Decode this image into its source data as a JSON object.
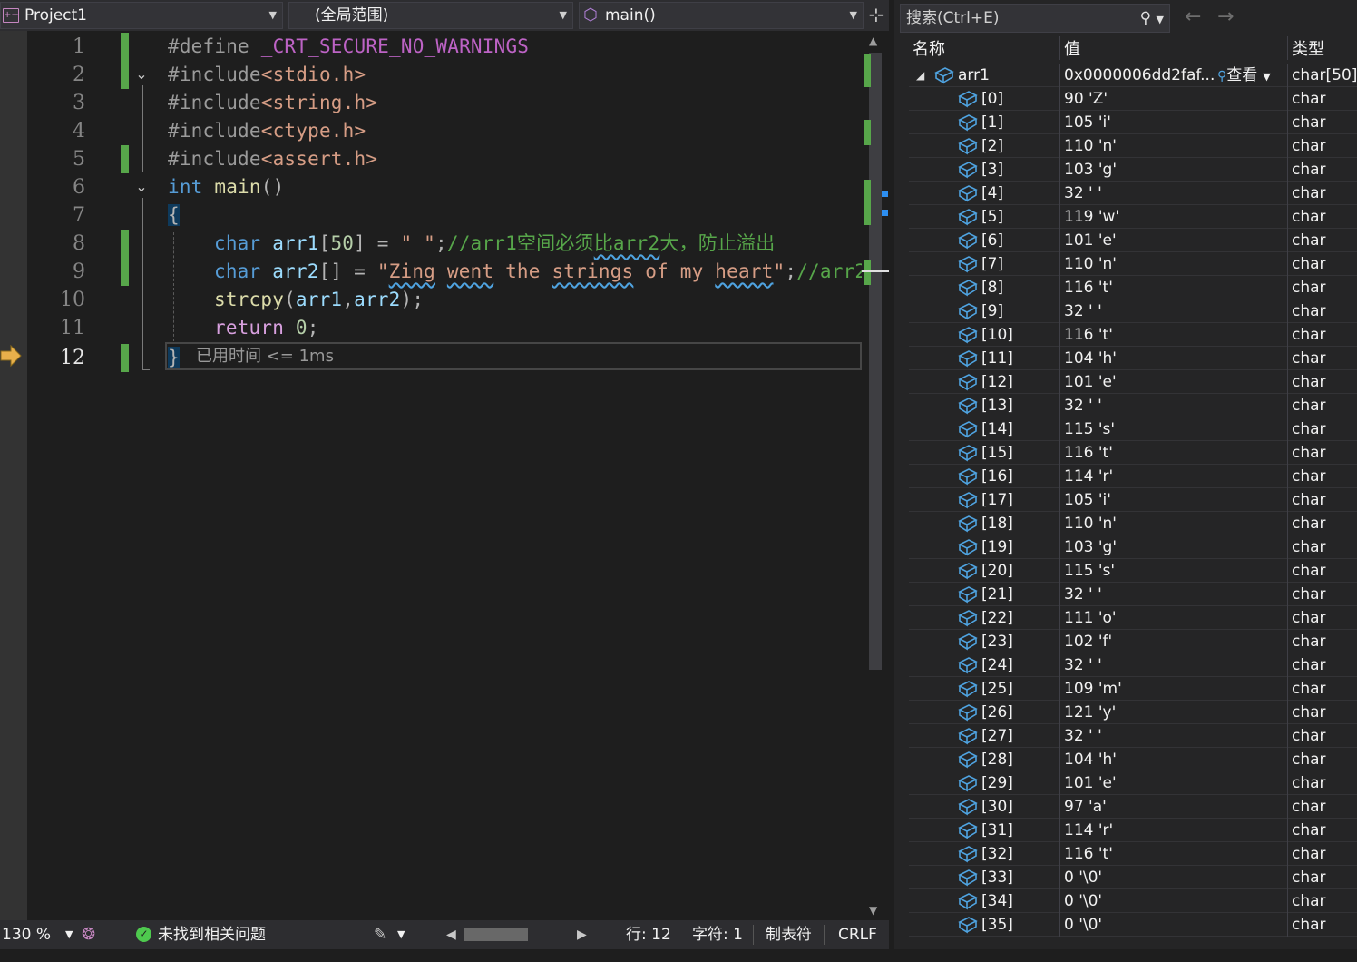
{
  "nav": {
    "project": "Project1",
    "scope": "(全局范围)",
    "function": "main()"
  },
  "code": {
    "line_numbers": [
      "1",
      "2",
      "3",
      "4",
      "5",
      "6",
      "7",
      "8",
      "9",
      "10",
      "11",
      "12"
    ],
    "l1_pp": "#define",
    "l1_macro": "_CRT_SECURE_NO_WARNINGS",
    "l2_pp": "#include",
    "l2_file": "<stdio.h>",
    "l3_pp": "#include",
    "l3_file": "<string.h>",
    "l4_pp": "#include",
    "l4_file": "<ctype.h>",
    "l5_pp": "#include",
    "l5_file": "<assert.h>",
    "l6_type": "int",
    "l6_fn": "main",
    "l6_paren": "()",
    "l7": "{",
    "l8_type": "char",
    "l8_var": "arr1",
    "l8_br1": "[",
    "l8_num": "50",
    "l8_br2": "]",
    "l8_eq": " = ",
    "l8_str": "\" \"",
    "l8_semi": ";",
    "l8_cmt_a": "//arr1空间必须",
    "l8_cmt_b": "比arr2",
    "l8_cmt_c": "大，防止溢出",
    "l9_type": "char",
    "l9_var": "arr2",
    "l9_br": "[]",
    "l9_eq": " = ",
    "l9_s1": "\"",
    "l9_w1": "Zing",
    "l9_w2": "went",
    "l9_w3": "the",
    "l9_w4": "strings",
    "l9_w5": "of",
    "l9_w6": "my",
    "l9_w7": "heart",
    "l9_s2": "\"",
    "l9_semi": ";",
    "l9_cmt": "//arr2",
    "l10_fn": "strcpy",
    "l10_p1": "(",
    "l10_a1": "arr1",
    "l10_c": ",",
    "l10_a2": "arr2",
    "l10_p2": ");",
    "l11_kw": "return",
    "l11_num": "0",
    "l11_semi": ";",
    "l12": "}",
    "elapsed": "已用时间 <= 1ms"
  },
  "status": {
    "zoom": "130 %",
    "issues": "未找到相关问题",
    "line": "行: 12",
    "char": "字符: 1",
    "indent": "制表符",
    "eol": "CRLF"
  },
  "watch": {
    "search_placeholder": "搜索(Ctrl+E)",
    "col_name": "名称",
    "col_value": "值",
    "col_type": "类型",
    "root": {
      "name": "arr1",
      "value": "0x0000006dd2faf...",
      "viewer": "查看",
      "type": "char[50]"
    },
    "items": [
      {
        "name": "[0]",
        "value": "90 'Z'",
        "type": "char"
      },
      {
        "name": "[1]",
        "value": "105 'i'",
        "type": "char"
      },
      {
        "name": "[2]",
        "value": "110 'n'",
        "type": "char"
      },
      {
        "name": "[3]",
        "value": "103 'g'",
        "type": "char"
      },
      {
        "name": "[4]",
        "value": "32 ' '",
        "type": "char"
      },
      {
        "name": "[5]",
        "value": "119 'w'",
        "type": "char"
      },
      {
        "name": "[6]",
        "value": "101 'e'",
        "type": "char"
      },
      {
        "name": "[7]",
        "value": "110 'n'",
        "type": "char"
      },
      {
        "name": "[8]",
        "value": "116 't'",
        "type": "char"
      },
      {
        "name": "[9]",
        "value": "32 ' '",
        "type": "char"
      },
      {
        "name": "[10]",
        "value": "116 't'",
        "type": "char"
      },
      {
        "name": "[11]",
        "value": "104 'h'",
        "type": "char"
      },
      {
        "name": "[12]",
        "value": "101 'e'",
        "type": "char"
      },
      {
        "name": "[13]",
        "value": "32 ' '",
        "type": "char"
      },
      {
        "name": "[14]",
        "value": "115 's'",
        "type": "char"
      },
      {
        "name": "[15]",
        "value": "116 't'",
        "type": "char"
      },
      {
        "name": "[16]",
        "value": "114 'r'",
        "type": "char"
      },
      {
        "name": "[17]",
        "value": "105 'i'",
        "type": "char"
      },
      {
        "name": "[18]",
        "value": "110 'n'",
        "type": "char"
      },
      {
        "name": "[19]",
        "value": "103 'g'",
        "type": "char"
      },
      {
        "name": "[20]",
        "value": "115 's'",
        "type": "char"
      },
      {
        "name": "[21]",
        "value": "32 ' '",
        "type": "char"
      },
      {
        "name": "[22]",
        "value": "111 'o'",
        "type": "char"
      },
      {
        "name": "[23]",
        "value": "102 'f'",
        "type": "char"
      },
      {
        "name": "[24]",
        "value": "32 ' '",
        "type": "char"
      },
      {
        "name": "[25]",
        "value": "109 'm'",
        "type": "char"
      },
      {
        "name": "[26]",
        "value": "121 'y'",
        "type": "char"
      },
      {
        "name": "[27]",
        "value": "32 ' '",
        "type": "char"
      },
      {
        "name": "[28]",
        "value": "104 'h'",
        "type": "char"
      },
      {
        "name": "[29]",
        "value": "101 'e'",
        "type": "char"
      },
      {
        "name": "[30]",
        "value": "97 'a'",
        "type": "char"
      },
      {
        "name": "[31]",
        "value": "114 'r'",
        "type": "char"
      },
      {
        "name": "[32]",
        "value": "116 't'",
        "type": "char"
      },
      {
        "name": "[33]",
        "value": "0 '\\0'",
        "type": "char"
      },
      {
        "name": "[34]",
        "value": "0 '\\0'",
        "type": "char"
      },
      {
        "name": "[35]",
        "value": "0 '\\0'",
        "type": "char"
      }
    ]
  },
  "colors": {
    "editor_bg": "#1e1e1e",
    "change_bar": "#57a64a",
    "keyword": "#569cd6",
    "string": "#d69d85",
    "comment": "#57a64a",
    "function": "#dcdcaa",
    "variable": "#9cdcfe",
    "number": "#b5cea8",
    "exec_arrow": "#e8b04b"
  },
  "icons": [
    "project-icon",
    "cube-icon",
    "split-icon",
    "execution-arrow-icon",
    "collapse-icon",
    "fold-icon",
    "check-circle-icon",
    "brush-icon",
    "search-icon",
    "back-arrow-icon",
    "forward-arrow-icon",
    "variable-icon",
    "magnifier-icon"
  ]
}
